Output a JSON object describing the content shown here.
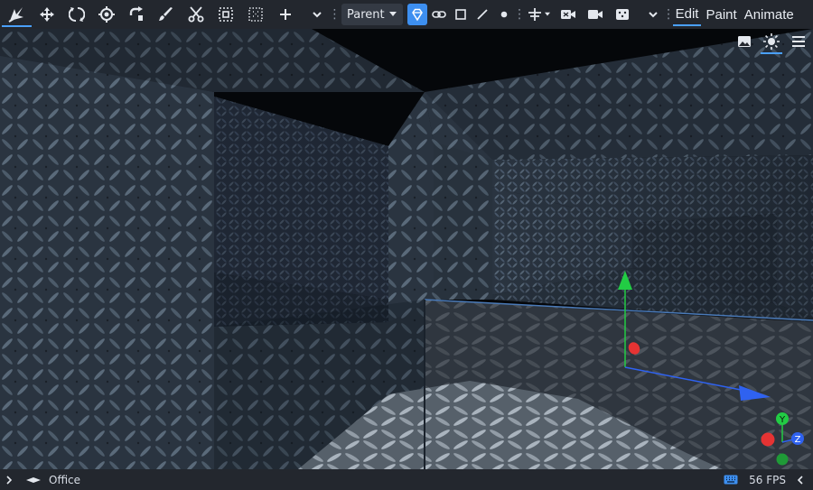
{
  "toolbar": {
    "tools": [
      "select-tool",
      "move-tool",
      "rotate-tool",
      "scale-tool",
      "transform-tool",
      "paint-tool",
      "cut-tool",
      "marquee-select-tool",
      "dotted-select-tool",
      "add-tool"
    ],
    "parent_label": "Parent",
    "modes": {
      "edit": "Edit",
      "paint": "Paint",
      "animate": "Animate"
    },
    "active_mode": "Edit"
  },
  "viewport": {
    "camera": "perspective",
    "render_mode": "lit",
    "gizmo": {
      "y_label": "Y",
      "z_label": "Z"
    }
  },
  "status": {
    "scene_name": "Office",
    "fps": "56 FPS"
  },
  "colors": {
    "accent": "#3d8ff0",
    "axis_x": "#e53333",
    "axis_y": "#22cc44",
    "axis_z": "#2f62f0"
  }
}
